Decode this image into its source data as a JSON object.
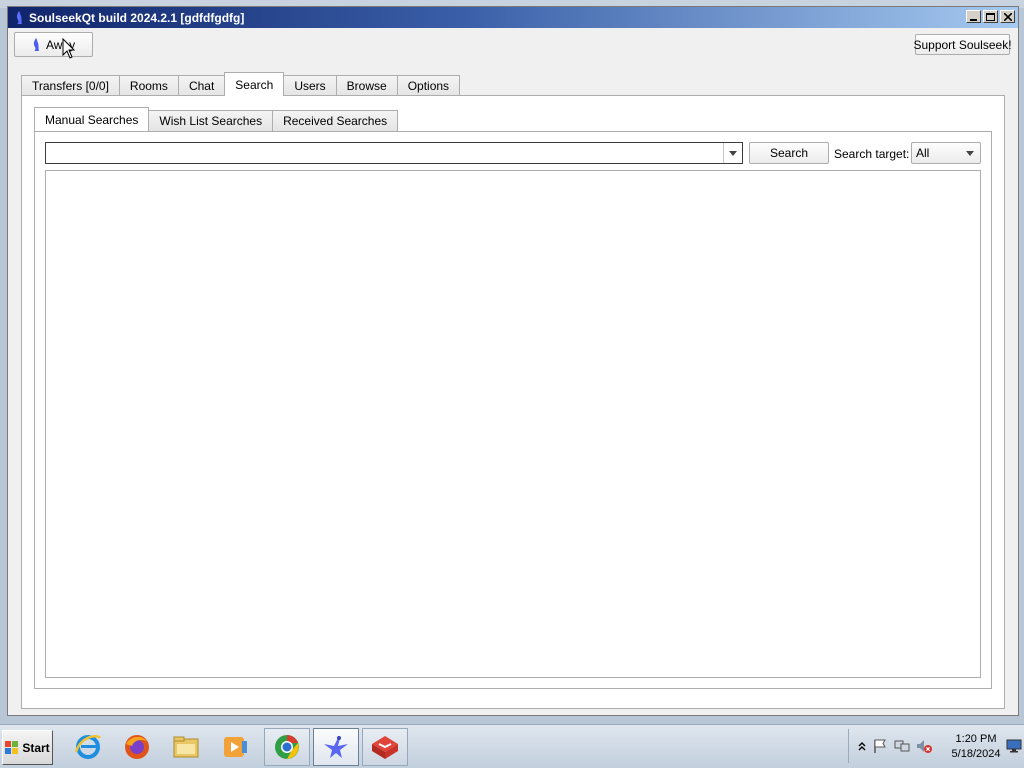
{
  "window": {
    "title": "SoulseekQt build 2024.2.1 [gdfdfgdfg]",
    "controls": {
      "minimize": "minimize",
      "maximize": "maximize",
      "close": "close"
    }
  },
  "toolbar": {
    "away_label": "Away",
    "support_label": "Support Soulseek!"
  },
  "tabs": [
    {
      "label": "Transfers [0/0]",
      "active": false
    },
    {
      "label": "Rooms",
      "active": false
    },
    {
      "label": "Chat",
      "active": false
    },
    {
      "label": "Search",
      "active": true
    },
    {
      "label": "Users",
      "active": false
    },
    {
      "label": "Browse",
      "active": false
    },
    {
      "label": "Options",
      "active": false
    }
  ],
  "search": {
    "subtabs": [
      {
        "label": "Manual Searches",
        "active": true
      },
      {
        "label": "Wish List Searches",
        "active": false
      },
      {
        "label": "Received Searches",
        "active": false
      }
    ],
    "query_value": "",
    "search_button": "Search",
    "target_label": "Search target:",
    "target_value": "All"
  },
  "taskbar": {
    "start_label": "Start",
    "apps": [
      {
        "icon": "internet-explorer-icon",
        "state": "normal"
      },
      {
        "icon": "firefox-icon",
        "state": "normal"
      },
      {
        "icon": "file-explorer-icon",
        "state": "normal"
      },
      {
        "icon": "media-player-icon",
        "state": "normal"
      },
      {
        "icon": "chrome-icon",
        "state": "pinned"
      },
      {
        "icon": "soulseek-icon",
        "state": "active"
      },
      {
        "icon": "red-cube-app-icon",
        "state": "pinned"
      }
    ],
    "clock": {
      "time": "1:20 PM",
      "date": "5/18/2024"
    }
  },
  "colors": {
    "titlebar_start": "#10246a",
    "titlebar_end": "#a6caf0",
    "taskbar": "#c2cfdd",
    "window_bg": "#f0f0f0"
  }
}
